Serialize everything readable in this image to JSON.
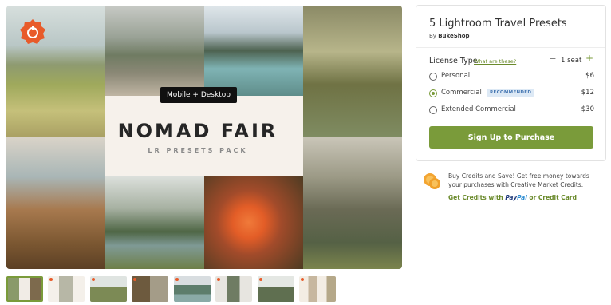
{
  "collage": {
    "tag": "Mobile + Desktop",
    "title": "NOMAD FAIR",
    "subtitle": "LR PRESETS PACK"
  },
  "product": {
    "title": "5 Lightroom Travel Presets",
    "by_prefix": "By",
    "author": "BukeShop"
  },
  "license": {
    "label": "License Type",
    "what_link": "What are these?",
    "minus": "−",
    "plus": "+",
    "seats": "1 seat",
    "options": [
      {
        "name": "Personal",
        "price": "$6",
        "selected": false
      },
      {
        "name": "Commercial",
        "price": "$12",
        "selected": true,
        "badge": "RECOMMENDED"
      },
      {
        "name": "Extended Commercial",
        "price": "$30",
        "selected": false
      }
    ]
  },
  "buy_button": "Sign Up to Purchase",
  "credits": {
    "text": "Buy Credits and Save! Get free money towards your purchases with Creative Market Credits.",
    "link_prefix": "Get Credits with",
    "paypal_1": "Pay",
    "paypal_2": "Pal",
    "link_suffix": "or Credit Card"
  },
  "thumbnail_active_index": 0,
  "colors": {
    "accent": "#7a9b3a",
    "badge_orange": "#e85b2a",
    "recommended_bg": "#dde9f5"
  }
}
